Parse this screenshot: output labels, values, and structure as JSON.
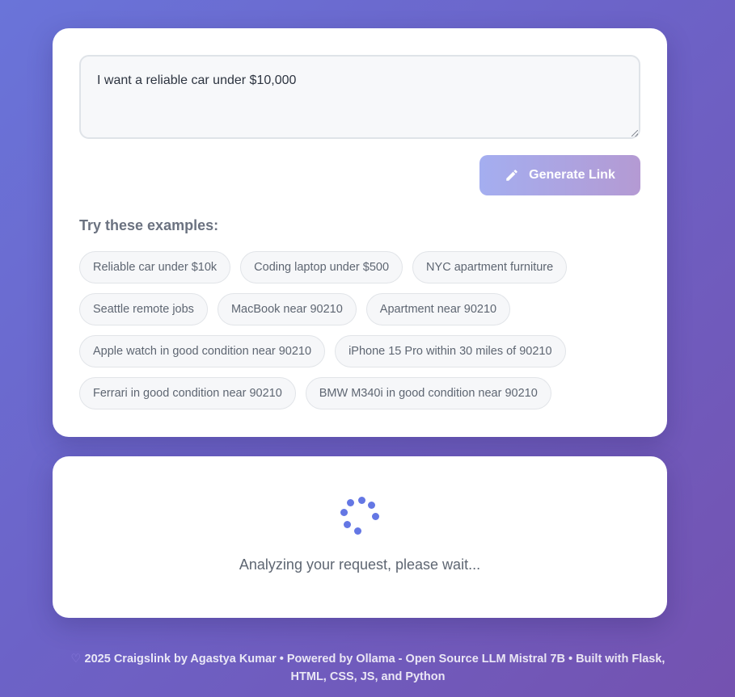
{
  "query": {
    "value": "I want a reliable car under $10,000"
  },
  "generate_button": {
    "label": "Generate Link",
    "icon": "pencil-icon"
  },
  "examples": {
    "title": "Try these examples:",
    "rows": [
      [
        "Reliable car under $10k",
        "Coding laptop under $500",
        "NYC apartment furniture"
      ],
      [
        "Seattle remote jobs",
        "MacBook near 90210",
        "Apartment near 90210"
      ],
      [
        "Apple watch in good condition near 90210",
        "iPhone 15 Pro within 30 miles of 90210"
      ],
      [
        "Ferrari in good condition near 90210",
        "BMW M340i in good condition near 90210"
      ]
    ]
  },
  "loading": {
    "text": "Analyzing your request, please wait...",
    "icon": "spinner-icon"
  },
  "footer": {
    "heart_icon": "heart-icon",
    "line1": "2025 Craigslink by Agastya Kumar • Powered by Ollama - Open Source LLM Mistral 7B • Built with Flask,",
    "line2": "HTML, CSS, JS, and Python"
  },
  "colors": {
    "accent": "#667eea",
    "button_gradient_start": "#a4aef0",
    "button_gradient_end": "#b49ad3",
    "background_start": "#6a74d9",
    "background_end": "#7452b0"
  }
}
